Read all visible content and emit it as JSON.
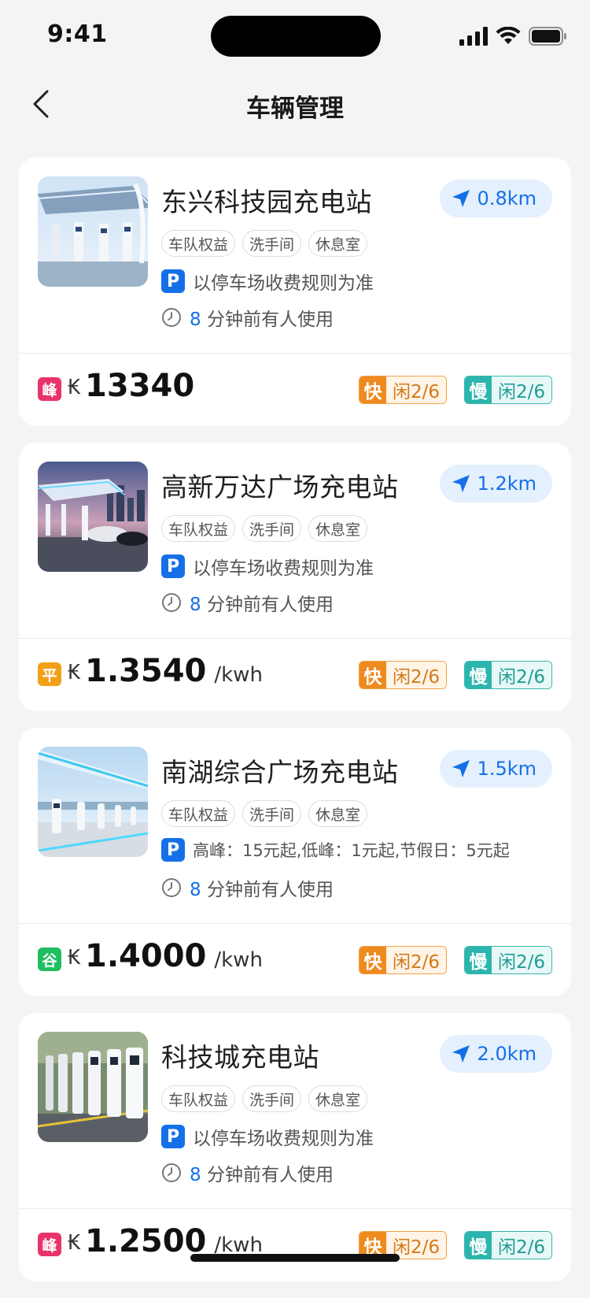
{
  "status": {
    "time": "9:41"
  },
  "nav": {
    "title": "车辆管理"
  },
  "stations": [
    {
      "name": "东兴科技园充电站",
      "distance": "0.8km",
      "tags": [
        "车队权益",
        "洗手间",
        "休息室"
      ],
      "parking": "以停车场收费规则为准",
      "usage_count": "8",
      "usage_text": "分钟前有人使用",
      "period": "峰",
      "period_color": "#e8336b",
      "currency": "₭",
      "price": "13340",
      "unit": "",
      "fast_label": "快",
      "fast_status": "闲2/6",
      "slow_label": "慢",
      "slow_status": "闲2/6"
    },
    {
      "name": "高新万达广场充电站",
      "distance": "1.2km",
      "tags": [
        "车队权益",
        "洗手间",
        "休息室"
      ],
      "parking": "以停车场收费规则为准",
      "usage_count": "8",
      "usage_text": "分钟前有人使用",
      "period": "平",
      "period_color": "#f2a019",
      "currency": "₭",
      "price": "1.3540",
      "unit": "/kwh",
      "fast_label": "快",
      "fast_status": "闲2/6",
      "slow_label": "慢",
      "slow_status": "闲2/6"
    },
    {
      "name": "南湖综合广场充电站",
      "distance": "1.5km",
      "tags": [
        "车队权益",
        "洗手间",
        "休息室"
      ],
      "parking": "高峰：15元起,低峰：1元起,节假日：5元起",
      "usage_count": "8",
      "usage_text": "分钟前有人使用",
      "period": "谷",
      "period_color": "#1fbf5f",
      "currency": "₭",
      "price": "1.4000",
      "unit": "/kwh",
      "fast_label": "快",
      "fast_status": "闲2/6",
      "slow_label": "慢",
      "slow_status": "闲2/6"
    },
    {
      "name": "科技城充电站",
      "distance": "2.0km",
      "tags": [
        "车队权益",
        "洗手间",
        "休息室"
      ],
      "parking": "以停车场收费规则为准",
      "usage_count": "8",
      "usage_text": "分钟前有人使用",
      "period": "峰",
      "period_color": "#e8336b",
      "currency": "₭",
      "price": "1.2500",
      "unit": "/kwh",
      "fast_label": "快",
      "fast_status": "闲2/6",
      "slow_label": "慢",
      "slow_status": "闲2/6"
    }
  ]
}
